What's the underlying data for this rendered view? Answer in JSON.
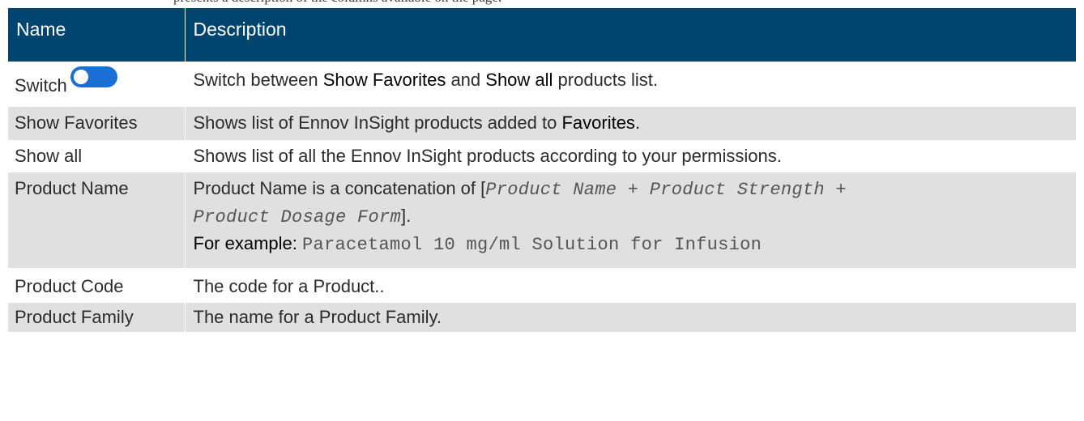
{
  "top_fragment": "presents a description of the columns available on the page:",
  "table": {
    "headers": {
      "name": "Name",
      "description": "Description"
    },
    "rows": {
      "switch": {
        "name": "Switch",
        "desc_pre": "Switch between ",
        "term1": "Show Favorites",
        "desc_mid": " and ",
        "term2": "Show all",
        "desc_post": " products list."
      },
      "favorites": {
        "name": "Show Favorites",
        "desc_pre": "Shows list of Ennov InSight products added to ",
        "term": "Favorites",
        "desc_post": "."
      },
      "all": {
        "name": "Show all",
        "desc": "Shows list of all the Ennov InSight products according to your permissions."
      },
      "product_name": {
        "name": "Product Name",
        "desc_pre": "Product Name is a concatenation of [",
        "formula_line1": "Product Name + Product Strength +",
        "formula_line2": "Product Dosage Form",
        "desc_post": "].",
        "example_label": "For example: ",
        "example_value": "Paracetamol 10 mg/ml Solution for Infusion"
      },
      "product_code": {
        "name": "Product Code",
        "desc": "The code for a Product.."
      },
      "product_family": {
        "name": "Product Family",
        "desc": "The name for a Product Family."
      }
    }
  },
  "colors": {
    "header_bg": "#004570",
    "row_gray": "#e0e0e0",
    "toggle_blue": "#1a6fd6"
  },
  "icons": {
    "switch_toggle": "toggle-switch-icon"
  }
}
